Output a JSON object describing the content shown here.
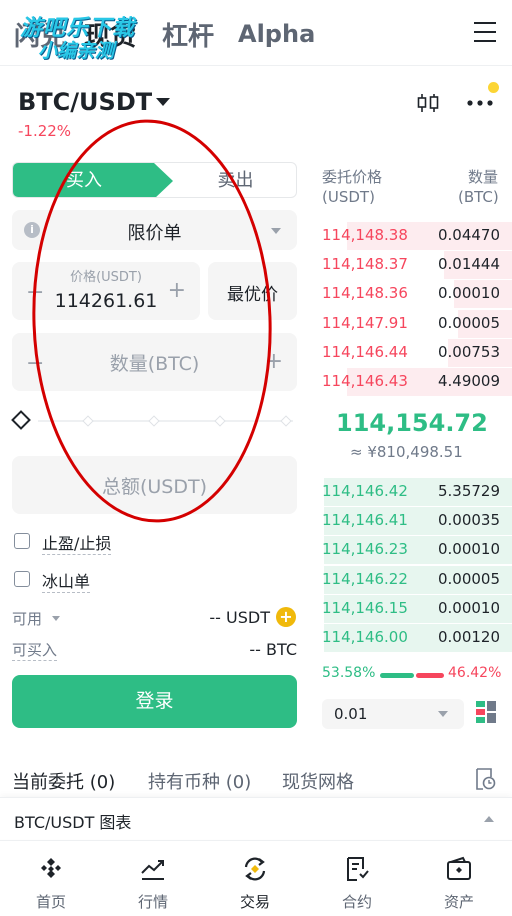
{
  "top_tabs": [
    {
      "label": "闪兑"
    },
    {
      "label": "现货"
    },
    {
      "label": "杠杆"
    },
    {
      "label": "Alpha"
    }
  ],
  "watermark": {
    "line1": "游吧乐下载",
    "line2": "小编亲测"
  },
  "pair": {
    "symbol": "BTC/USDT",
    "change": "-1.22%"
  },
  "trade": {
    "buy_label": "买入",
    "sell_label": "卖出",
    "order_type": "限价单",
    "price_label": "价格(USDT)",
    "price_value": "114261.61",
    "best_price_label": "最优价",
    "quantity_placeholder": "数量(BTC)",
    "total_placeholder": "总额(USDT)",
    "tp_sl_label": "止盈/止损",
    "iceberg_label": "冰山单",
    "available_label": "可用",
    "available_value": "-- USDT",
    "can_buy_label": "可买入",
    "can_buy_value": "-- BTC",
    "login_label": "登录",
    "minus": "−",
    "plus": "+",
    "add": "+",
    "info": "i"
  },
  "orderbook": {
    "price_header": "委托价格",
    "price_unit": "(USDT)",
    "qty_header": "数量",
    "qty_unit": "(BTC)",
    "asks": [
      {
        "price": "114,148.38",
        "qty": "0.04470",
        "depth": 0.85
      },
      {
        "price": "114,148.37",
        "qty": "0.01444",
        "depth": 0.35
      },
      {
        "price": "114,148.36",
        "qty": "0.00010",
        "depth": 0.3
      },
      {
        "price": "114,147.91",
        "qty": "0.00005",
        "depth": 0.28
      },
      {
        "price": "114,146.44",
        "qty": "0.00753",
        "depth": 0.33
      },
      {
        "price": "114,146.43",
        "qty": "4.49009",
        "depth": 0.85
      }
    ],
    "last_price": "114,154.72",
    "last_price_cny": "≈ ¥810,498.51",
    "bids": [
      {
        "price": "114,146.42",
        "qty": "5.35729",
        "depth": 0.97
      },
      {
        "price": "114,146.41",
        "qty": "0.00035",
        "depth": 0.97
      },
      {
        "price": "114,146.23",
        "qty": "0.00010",
        "depth": 0.97
      },
      {
        "price": "114,146.22",
        "qty": "0.00005",
        "depth": 0.97
      },
      {
        "price": "114,146.15",
        "qty": "0.00010",
        "depth": 0.97
      },
      {
        "price": "114,146.00",
        "qty": "0.00120",
        "depth": 0.97
      }
    ],
    "buy_ratio": "53.58%",
    "sell_ratio": "46.42%",
    "depth_step": "0.01"
  },
  "orders": {
    "tabs": [
      "当前委托 (0)",
      "持有币种 (0)",
      "现货网格"
    ]
  },
  "chart_bar": {
    "label": "BTC/USDT 图表"
  },
  "bottom_nav": [
    {
      "label": "首页",
      "icon": "home-icon"
    },
    {
      "label": "行情",
      "icon": "markets-icon"
    },
    {
      "label": "交易",
      "icon": "trade-icon"
    },
    {
      "label": "合约",
      "icon": "futures-icon"
    },
    {
      "label": "资产",
      "icon": "wallet-icon"
    }
  ],
  "colors": {
    "green": "#2ebd85",
    "red": "#f6465d",
    "yellow": "#fcd535",
    "annotation": "#d40000"
  }
}
